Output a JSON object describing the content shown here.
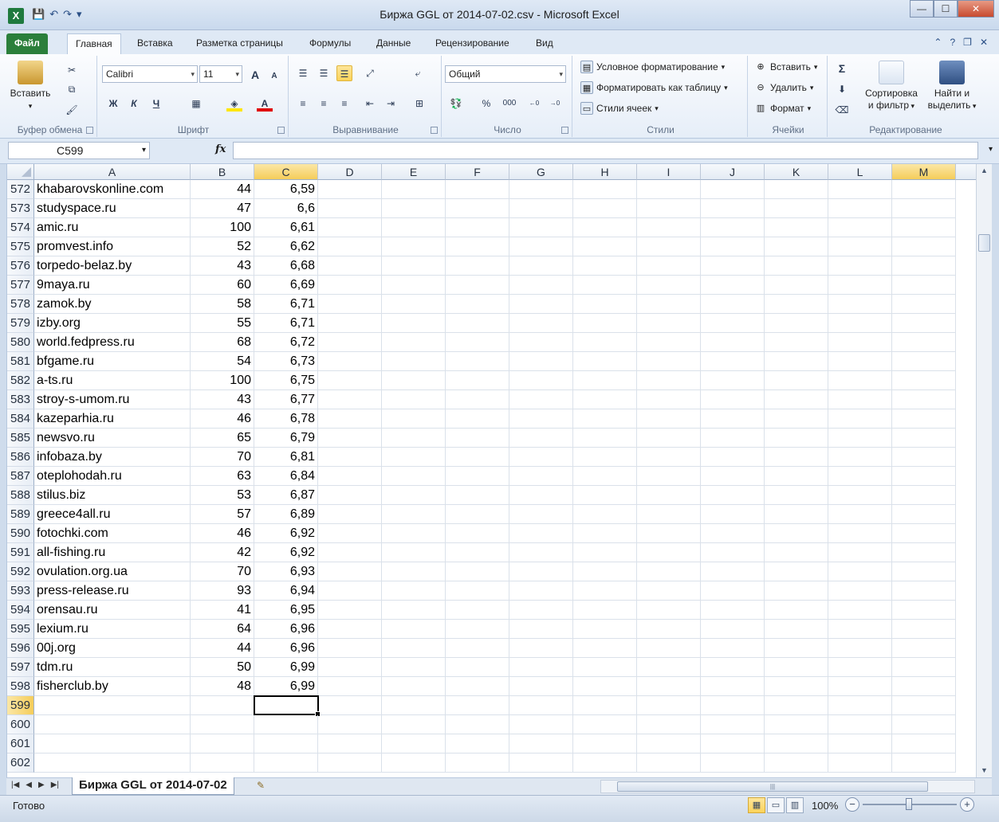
{
  "window": {
    "title": "Биржа GGL от 2014-07-02.csv  -  Microsoft Excel",
    "app_icon_label": "X",
    "minimize": "—",
    "maximize": "☐",
    "close": "✕"
  },
  "qat": {
    "save": "💾",
    "undo": "↶",
    "redo": "↷",
    "more": "▾"
  },
  "tabs": {
    "file": "Файл",
    "items": [
      "Главная",
      "Вставка",
      "Разметка страницы",
      "Формулы",
      "Данные",
      "Рецензирование",
      "Вид"
    ],
    "active_index": 0
  },
  "ribbon": {
    "clipboard": {
      "label": "Буфер обмена",
      "paste": "Вставить"
    },
    "font": {
      "label": "Шрифт",
      "font_name": "Calibri",
      "font_size": "11",
      "bold": "Ж",
      "italic": "К",
      "underline": "Ч",
      "grow": "A",
      "shrink": "A"
    },
    "alignment": {
      "label": "Выравнивание"
    },
    "number": {
      "label": "Число",
      "format": "Общий",
      "percent": "%",
      "thousands": "000",
      "inc_dec": ",0 ,00",
      "dec_dec": ",00 ,0"
    },
    "styles": {
      "label": "Стили",
      "conditional": "Условное форматирование",
      "as_table": "Форматировать как таблицу",
      "cell_styles": "Стили ячеек"
    },
    "cells": {
      "label": "Ячейки",
      "insert": "Вставить",
      "delete": "Удалить",
      "format": "Формат"
    },
    "editing": {
      "label": "Редактирование",
      "sum": "Σ",
      "sort_line1": "Сортировка",
      "sort_line2": "и фильтр",
      "find_line1": "Найти и",
      "find_line2": "выделить"
    }
  },
  "formula_bar": {
    "name_box": "C599",
    "fx": "fx",
    "formula": ""
  },
  "columns": [
    "A",
    "B",
    "C",
    "D",
    "E",
    "F",
    "G",
    "H",
    "I",
    "J",
    "K",
    "L",
    "M"
  ],
  "selected_column": "C",
  "highlight_column": "M",
  "rows": [
    {
      "n": "572",
      "a": "khabarovskonline.com",
      "b": "44",
      "c": "6,59"
    },
    {
      "n": "573",
      "a": "studyspace.ru",
      "b": "47",
      "c": "6,6"
    },
    {
      "n": "574",
      "a": "amic.ru",
      "b": "100",
      "c": "6,61"
    },
    {
      "n": "575",
      "a": "promvest.info",
      "b": "52",
      "c": "6,62"
    },
    {
      "n": "576",
      "a": "torpedo-belaz.by",
      "b": "43",
      "c": "6,68"
    },
    {
      "n": "577",
      "a": "9maya.ru",
      "b": "60",
      "c": "6,69"
    },
    {
      "n": "578",
      "a": "zamok.by",
      "b": "58",
      "c": "6,71"
    },
    {
      "n": "579",
      "a": "izby.org",
      "b": "55",
      "c": "6,71"
    },
    {
      "n": "580",
      "a": "world.fedpress.ru",
      "b": "68",
      "c": "6,72"
    },
    {
      "n": "581",
      "a": "bfgame.ru",
      "b": "54",
      "c": "6,73"
    },
    {
      "n": "582",
      "a": "a-ts.ru",
      "b": "100",
      "c": "6,75"
    },
    {
      "n": "583",
      "a": "stroy-s-umom.ru",
      "b": "43",
      "c": "6,77"
    },
    {
      "n": "584",
      "a": "kazeparhia.ru",
      "b": "46",
      "c": "6,78"
    },
    {
      "n": "585",
      "a": "newsvo.ru",
      "b": "65",
      "c": "6,79"
    },
    {
      "n": "586",
      "a": "infobaza.by",
      "b": "70",
      "c": "6,81"
    },
    {
      "n": "587",
      "a": "oteplohodah.ru",
      "b": "63",
      "c": "6,84"
    },
    {
      "n": "588",
      "a": "stilus.biz",
      "b": "53",
      "c": "6,87"
    },
    {
      "n": "589",
      "a": "greece4all.ru",
      "b": "57",
      "c": "6,89"
    },
    {
      "n": "590",
      "a": "fotochki.com",
      "b": "46",
      "c": "6,92"
    },
    {
      "n": "591",
      "a": "all-fishing.ru",
      "b": "42",
      "c": "6,92"
    },
    {
      "n": "592",
      "a": "ovulation.org.ua",
      "b": "70",
      "c": "6,93"
    },
    {
      "n": "593",
      "a": "press-release.ru",
      "b": "93",
      "c": "6,94"
    },
    {
      "n": "594",
      "a": "orensau.ru",
      "b": "41",
      "c": "6,95"
    },
    {
      "n": "595",
      "a": "lexium.ru",
      "b": "64",
      "c": "6,96"
    },
    {
      "n": "596",
      "a": "00j.org",
      "b": "44",
      "c": "6,96"
    },
    {
      "n": "597",
      "a": "tdm.ru",
      "b": "50",
      "c": "6,99"
    },
    {
      "n": "598",
      "a": "fisherclub.by",
      "b": "48",
      "c": "6,99"
    },
    {
      "n": "599",
      "a": "",
      "b": "",
      "c": ""
    },
    {
      "n": "600",
      "a": "",
      "b": "",
      "c": ""
    },
    {
      "n": "601",
      "a": "",
      "b": "",
      "c": ""
    },
    {
      "n": "602",
      "a": "",
      "b": "",
      "c": ""
    }
  ],
  "selected_row": "599",
  "sheet_tab": "Биржа GGL от 2014-07-02",
  "status": {
    "ready": "Готово",
    "zoom": "100%"
  }
}
